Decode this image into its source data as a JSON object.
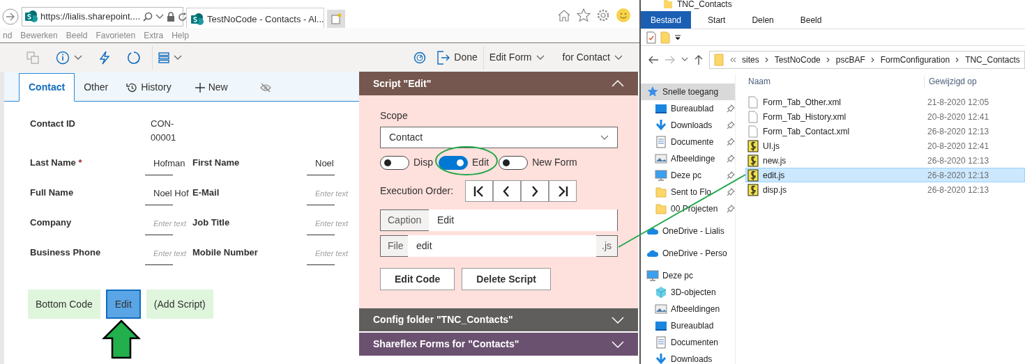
{
  "browser": {
    "address": "https://lialis.sharepoint....",
    "tab_title": "TestNoCode - Contacts - Al...",
    "menu": [
      "nd",
      "Bewerken",
      "Beeld",
      "Favorieten",
      "Extra",
      "Help"
    ]
  },
  "toolbar": {
    "actions": [
      {
        "label": "Done",
        "kind": "exit"
      },
      {
        "label": "Edit Form",
        "kind": "dropdown"
      },
      {
        "label": "for Contact",
        "kind": "dropdown"
      }
    ]
  },
  "form": {
    "required_mark": "*",
    "tabs": [
      {
        "label": "Contact",
        "kind": "text",
        "selected": true
      },
      {
        "label": "Other",
        "kind": "text",
        "selected": false
      },
      {
        "label": "History",
        "kind": "history",
        "selected": false
      },
      {
        "label": "New",
        "kind": "new",
        "selected": false
      },
      {
        "kind": "hidden",
        "selected": false
      }
    ],
    "rows": [
      [
        {
          "label": "Contact ID",
          "required": false,
          "kind": "static",
          "value": "CON-00001"
        }
      ],
      [
        {
          "label": "Last Name",
          "required": true,
          "kind": "input",
          "value": "Hofman"
        },
        {
          "label": "First Name",
          "required": false,
          "kind": "input",
          "value": "Noel"
        }
      ],
      [
        {
          "label": "Full Name",
          "required": false,
          "kind": "input",
          "value": "Noel Hof"
        },
        {
          "label": "E-Mail",
          "required": false,
          "kind": "input",
          "placeholder": "Enter text"
        }
      ],
      [
        {
          "label": "Company",
          "required": false,
          "kind": "input",
          "placeholder": "Enter text"
        },
        {
          "label": "Job Title",
          "required": false,
          "kind": "input",
          "placeholder": "Enter text"
        }
      ],
      [
        {
          "label": "Business Phone",
          "required": false,
          "kind": "input",
          "placeholder": "Enter text"
        },
        {
          "label": "Mobile Number",
          "required": false,
          "kind": "input",
          "placeholder": "Enter text"
        }
      ]
    ],
    "buttons": [
      {
        "label": "Bottom Code",
        "selected": false
      },
      {
        "label": "Edit",
        "selected": true
      },
      {
        "label": "(Add Script)",
        "selected": false
      }
    ]
  },
  "panel": {
    "title": "Script \"Edit\"",
    "expanded": true,
    "scope_label": "Scope",
    "scope_value": "Contact",
    "toggles": [
      {
        "label": "Disp",
        "on": false
      },
      {
        "label": "Edit",
        "on": true
      },
      {
        "label": "New Form",
        "on": false
      }
    ],
    "execution_order_label": "Execution Order:",
    "caption_label": "Caption",
    "caption_value": "Edit",
    "file_label": "File",
    "file_value": "edit",
    "file_suffix": ".js",
    "actions": [
      "Edit Code",
      "Delete Script"
    ]
  },
  "sections": [
    {
      "title": "Config folder \"TNC_Contacts\"",
      "color": "#5f5e5c",
      "expanded": false
    },
    {
      "title": "Shareflex Forms for \"Contacts\"",
      "color": "#6b5170",
      "expanded": false
    }
  ],
  "explorer": {
    "title": "TNC_Contacts",
    "ribbon_tabs": [
      {
        "label": "Bestand",
        "selected": true
      },
      {
        "label": "Start",
        "selected": false
      },
      {
        "label": "Delen",
        "selected": false
      },
      {
        "label": "Beeld",
        "selected": false
      }
    ],
    "breadcrumb": [
      "sites",
      "TestNoCode",
      "pscBAF",
      "FormConfiguration",
      "TNC_Contacts"
    ],
    "columns": [
      "Naam",
      "Gewijzigd op"
    ],
    "nav": [
      {
        "label": "Snelle toegang",
        "kind": "star",
        "selected": true,
        "pinned": false,
        "children": [
          {
            "label": "Bureaublad",
            "kind": "desktop",
            "selected": false,
            "pinned": true
          },
          {
            "label": "Downloads",
            "kind": "download",
            "selected": false,
            "pinned": true
          },
          {
            "label": "Documente",
            "kind": "documents",
            "selected": false,
            "pinned": true
          },
          {
            "label": "Afbeeldinge",
            "kind": "pictures",
            "selected": false,
            "pinned": true
          },
          {
            "label": "Deze pc",
            "kind": "pc",
            "selected": false,
            "pinned": true
          },
          {
            "label": "Sent to Flo",
            "kind": "folder",
            "selected": false,
            "pinned": true
          },
          {
            "label": "00 Projecten",
            "kind": "folder",
            "selected": false,
            "pinned": true
          }
        ]
      },
      {
        "label": "OneDrive - Lialis",
        "kind": "cloud",
        "selected": false,
        "pinned": false
      },
      {
        "label": "OneDrive - Perso",
        "kind": "cloud",
        "selected": false,
        "pinned": false
      },
      {
        "label": "Deze pc",
        "kind": "pc",
        "selected": false,
        "pinned": false,
        "children": [
          {
            "label": "3D-objecten",
            "kind": "cube",
            "selected": false,
            "pinned": false
          },
          {
            "label": "Afbeeldingen",
            "kind": "pictures",
            "selected": false,
            "pinned": false
          },
          {
            "label": "Bureaublad",
            "kind": "desktop",
            "selected": false,
            "pinned": false
          },
          {
            "label": "Documenten",
            "kind": "documents",
            "selected": false,
            "pinned": false
          },
          {
            "label": "Downloads",
            "kind": "download",
            "selected": false,
            "pinned": false
          }
        ]
      }
    ],
    "files": [
      {
        "name": "Form_Tab_Other.xml",
        "modified": "21-8-2020 12:05",
        "kind": "xml",
        "selected": false
      },
      {
        "name": "Form_Tab_History.xml",
        "modified": "20-8-2020 12:41",
        "kind": "xml",
        "selected": false
      },
      {
        "name": "Form_Tab_Contact.xml",
        "modified": "26-8-2020 12:13",
        "kind": "xml",
        "selected": false
      },
      {
        "name": "UI.js",
        "modified": "20-8-2020 12:41",
        "kind": "js",
        "selected": false
      },
      {
        "name": "new.js",
        "modified": "26-8-2020 12:13",
        "kind": "js",
        "selected": false
      },
      {
        "name": "edit.js",
        "modified": "26-8-2020 12:13",
        "kind": "js",
        "selected": true
      },
      {
        "name": "disp.js",
        "modified": "26-8-2020 12:13",
        "kind": "js",
        "selected": false
      }
    ]
  }
}
